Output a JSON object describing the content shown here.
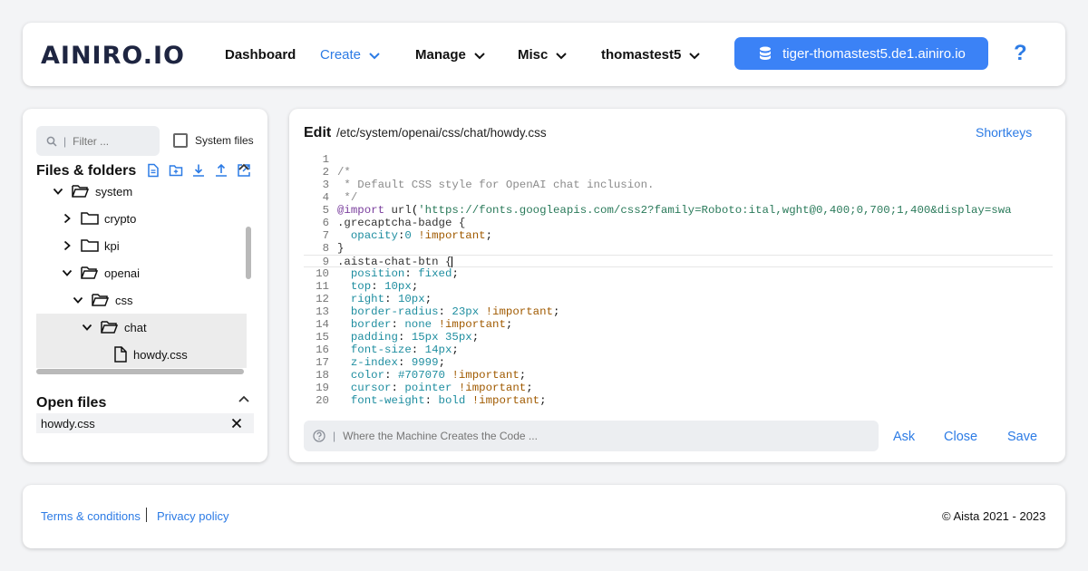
{
  "header": {
    "logo": "AINIRO.IO",
    "nav": [
      {
        "label": "Dashboard"
      },
      {
        "label": "Create"
      },
      {
        "label": "Manage"
      },
      {
        "label": "Misc"
      },
      {
        "label": "thomastest5"
      }
    ],
    "workspace": "tiger-thomastest5.de1.ainiro.io",
    "help": "?"
  },
  "sidebar": {
    "filter_placeholder": "Filter ...",
    "filter_separator": "|",
    "system_files_label": "System files",
    "files_title": "Files & folders",
    "tree": [
      {
        "label": "system"
      },
      {
        "label": "crypto"
      },
      {
        "label": "kpi"
      },
      {
        "label": "openai"
      },
      {
        "label": "css"
      },
      {
        "label": "chat"
      },
      {
        "label": "howdy.css"
      }
    ],
    "open_files_title": "Open files",
    "open_files": [
      {
        "label": "howdy.css"
      }
    ]
  },
  "editor": {
    "title": "Edit",
    "path": "/etc/system/openai/css/chat/howdy.css",
    "shortkeys": "Shortkeys",
    "lines": [
      {
        "n": "1",
        "text": ""
      },
      {
        "n": "2",
        "text": "/*"
      },
      {
        "n": "3",
        "text": " * Default CSS style for OpenAI chat inclusion."
      },
      {
        "n": "4",
        "text": " */"
      },
      {
        "n": "5",
        "text": "@import url('https://fonts.googleapis.com/css2?family=Roboto:ital,wght@0,400;0,700;1,400&display=swa"
      },
      {
        "n": "6",
        "text": ".grecaptcha-badge {"
      },
      {
        "n": "7",
        "text": "  opacity:0 !important;"
      },
      {
        "n": "8",
        "text": "}"
      },
      {
        "n": "9",
        "text": ".aista-chat-btn {"
      },
      {
        "n": "10",
        "text": "  position: fixed;"
      },
      {
        "n": "11",
        "text": "  top: 10px;"
      },
      {
        "n": "12",
        "text": "  right: 10px;"
      },
      {
        "n": "13",
        "text": "  border-radius: 23px !important;"
      },
      {
        "n": "14",
        "text": "  border: none !important;"
      },
      {
        "n": "15",
        "text": "  padding: 15px 35px;"
      },
      {
        "n": "16",
        "text": "  font-size: 14px;"
      },
      {
        "n": "17",
        "text": "  z-index: 9999;"
      },
      {
        "n": "18",
        "text": "  color: #707070 !important;"
      },
      {
        "n": "19",
        "text": "  cursor: pointer !important;"
      },
      {
        "n": "20",
        "text": "  font-weight: bold !important;"
      }
    ],
    "ask_separator": "|",
    "ask_placeholder": "Where the Machine Creates the Code ...",
    "actions": {
      "ask": "Ask",
      "close": "Close",
      "save": "Save"
    }
  },
  "footer": {
    "terms": "Terms & conditions",
    "privacy": "Privacy policy",
    "copyright": "© Aista 2021 - 2023"
  },
  "colors": {
    "accent": "#2c7be5",
    "button": "#3b82f6"
  }
}
